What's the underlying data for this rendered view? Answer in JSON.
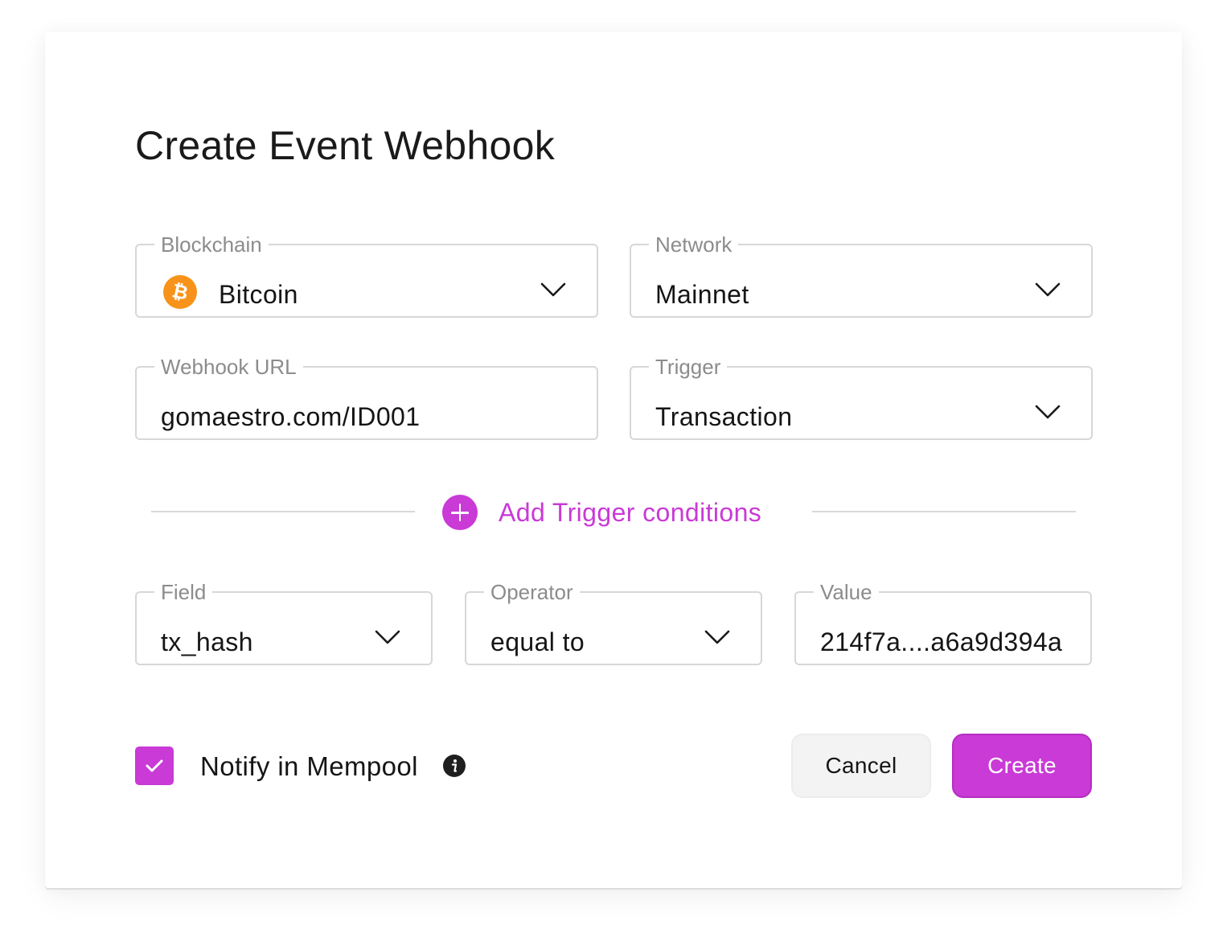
{
  "dialog": {
    "title": "Create Event Webhook"
  },
  "fields": {
    "blockchain": {
      "label": "Blockchain",
      "value": "Bitcoin",
      "icon": "bitcoin-icon"
    },
    "network": {
      "label": "Network",
      "value": "Mainnet"
    },
    "webhook_url": {
      "label": "Webhook URL",
      "value": "gomaestro.com/ID001"
    },
    "trigger": {
      "label": "Trigger",
      "value": "Transaction"
    }
  },
  "conditions": {
    "add_label": "Add Trigger conditions",
    "field": {
      "label": "Field",
      "value": "tx_hash"
    },
    "operator": {
      "label": "Operator",
      "value": "equal to"
    },
    "value": {
      "label": "Value",
      "value": "214f7a....a6a9d394a"
    }
  },
  "footer": {
    "notify_label": "Notify in Mempool",
    "notify_checked": true,
    "cancel_label": "Cancel",
    "create_label": "Create"
  },
  "colors": {
    "accent": "#c93ad6",
    "bitcoin": "#f7931a",
    "border": "#d7d7d7",
    "legend": "#8c8c8c"
  }
}
